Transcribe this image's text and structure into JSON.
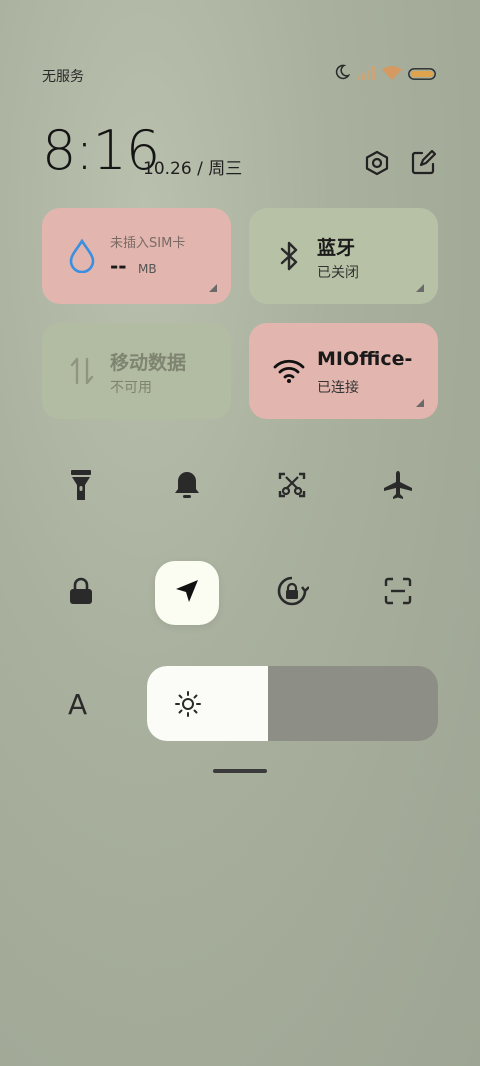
{
  "status_bar": {
    "carrier": "无服务",
    "icons": [
      "moon-icon",
      "signal-icon",
      "wifi-icon",
      "battery-icon"
    ]
  },
  "header": {
    "time": "8:16",
    "date": "10.26 / 周三",
    "buttons": [
      "settings-icon",
      "edit-icon"
    ]
  },
  "tiles": {
    "data_usage": {
      "title": "--",
      "unit": "MB",
      "subtitle": "未插入SIM卡",
      "icon": "water-drop-icon",
      "color": "#e2b6ae"
    },
    "bluetooth": {
      "title": "蓝牙",
      "subtitle": "已关闭",
      "icon": "bluetooth-icon",
      "color": "#b6c1a6"
    },
    "mobile_data": {
      "title": "移动数据",
      "subtitle": "不可用",
      "icon": "data-arrows-icon",
      "color": "#b2bca3"
    },
    "wifi": {
      "title": "MIOffice-",
      "subtitle": "已连接",
      "icon": "wifi-icon",
      "color": "#e2b6ae"
    }
  },
  "quick_toggles": [
    {
      "icon": "flashlight-icon",
      "active": false
    },
    {
      "icon": "bell-icon",
      "active": false
    },
    {
      "icon": "screenshot-icon",
      "active": false
    },
    {
      "icon": "airplane-icon",
      "active": false
    },
    {
      "icon": "lock-icon",
      "active": false
    },
    {
      "icon": "location-icon",
      "active": true
    },
    {
      "icon": "rotation-lock-icon",
      "active": false
    },
    {
      "icon": "scan-icon",
      "active": false
    }
  ],
  "brightness": {
    "auto_label": "A",
    "level": 0.415,
    "icon": "sun-icon"
  }
}
